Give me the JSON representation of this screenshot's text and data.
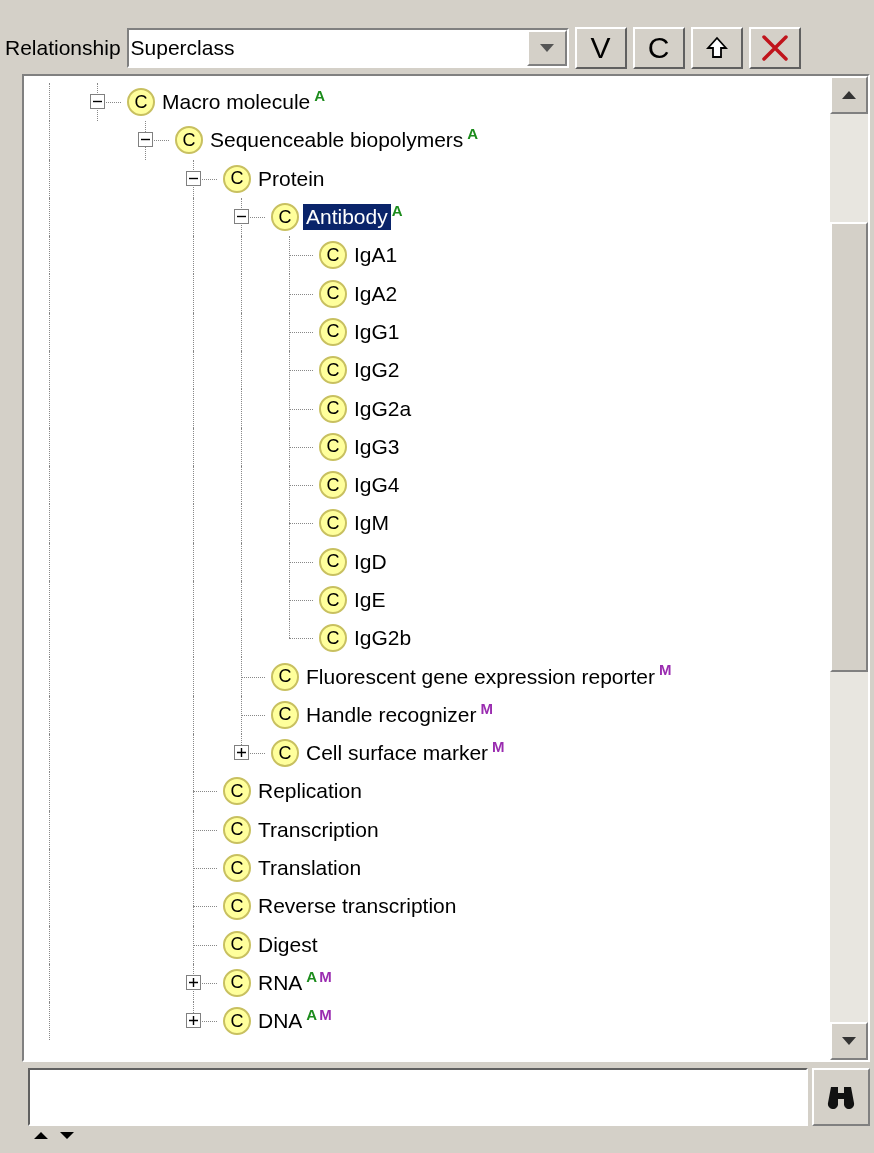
{
  "relationship": {
    "label": "Relationship",
    "value": "Superclass"
  },
  "toolbar": [
    {
      "kind": "text",
      "text": "V"
    },
    {
      "kind": "text",
      "text": "C"
    },
    {
      "kind": "up"
    },
    {
      "kind": "delete"
    }
  ],
  "tree": [
    {
      "label": "Macro molecule",
      "icon": "C",
      "expanded": true,
      "selected": false,
      "badges": [
        {
          "text": "A",
          "color": "#1c8c1c"
        }
      ],
      "children": [
        {
          "label": "Sequenceable biopolymers",
          "icon": "C",
          "expanded": true,
          "selected": false,
          "badges": [
            {
              "text": "A",
              "color": "#1c8c1c"
            }
          ],
          "children": [
            {
              "label": "Protein",
              "icon": "C",
              "expanded": true,
              "selected": false,
              "children": [
                {
                  "label": "Antibody",
                  "icon": "C",
                  "expanded": true,
                  "selected": true,
                  "badges": [
                    {
                      "text": "A",
                      "color": "#1c8c1c"
                    }
                  ],
                  "children": [
                    {
                      "label": "IgA1",
                      "icon": "C",
                      "selected": false
                    },
                    {
                      "label": "IgA2",
                      "icon": "C",
                      "selected": false
                    },
                    {
                      "label": "IgG1",
                      "icon": "C",
                      "selected": false
                    },
                    {
                      "label": "IgG2",
                      "icon": "C",
                      "selected": false
                    },
                    {
                      "label": "IgG2a",
                      "icon": "C",
                      "selected": false
                    },
                    {
                      "label": "IgG3",
                      "icon": "C",
                      "selected": false
                    },
                    {
                      "label": "IgG4",
                      "icon": "C",
                      "selected": false
                    },
                    {
                      "label": "IgM",
                      "icon": "C",
                      "selected": false
                    },
                    {
                      "label": "IgD",
                      "icon": "C",
                      "selected": false
                    },
                    {
                      "label": "IgE",
                      "icon": "C",
                      "selected": false
                    },
                    {
                      "label": "IgG2b",
                      "icon": "C",
                      "selected": false
                    }
                  ]
                },
                {
                  "label": "Fluorescent gene expression reporter",
                  "icon": "C",
                  "selected": false,
                  "badges": [
                    {
                      "text": "M",
                      "color": "#9a2cb0"
                    }
                  ]
                },
                {
                  "label": "Handle recognizer",
                  "icon": "C",
                  "selected": false,
                  "badges": [
                    {
                      "text": "M",
                      "color": "#9a2cb0"
                    }
                  ]
                },
                {
                  "label": "Cell surface marker",
                  "icon": "C",
                  "expanded": false,
                  "selected": false,
                  "badges": [
                    {
                      "text": "M",
                      "color": "#9a2cb0"
                    }
                  ]
                }
              ]
            },
            {
              "label": "Replication",
              "icon": "C",
              "selected": false
            },
            {
              "label": "Transcription",
              "icon": "C",
              "selected": false
            },
            {
              "label": "Translation",
              "icon": "C",
              "selected": false
            },
            {
              "label": "Reverse transcription",
              "icon": "C",
              "selected": false
            },
            {
              "label": "Digest",
              "icon": "C",
              "selected": false
            },
            {
              "label": "RNA",
              "icon": "C",
              "expanded": false,
              "selected": false,
              "badges": [
                {
                  "text": "A",
                  "color": "#1c8c1c"
                },
                {
                  "text": "M",
                  "color": "#9a2cb0"
                }
              ]
            },
            {
              "label": "DNA",
              "icon": "C",
              "expanded": false,
              "selected": false,
              "badges": [
                {
                  "text": "A",
                  "color": "#1c8c1c"
                },
                {
                  "text": "M",
                  "color": "#9a2cb0"
                }
              ]
            }
          ]
        }
      ]
    }
  ]
}
